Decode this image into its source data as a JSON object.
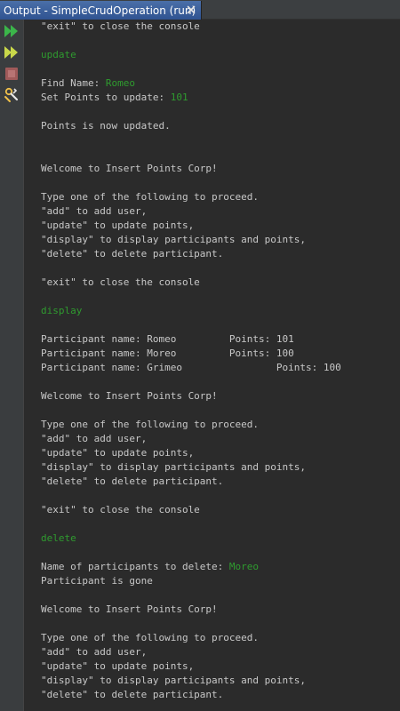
{
  "tab": {
    "title": "Output - SimpleCrudOperation (run)",
    "close_icon": "close-icon"
  },
  "toolbar": {
    "icons": [
      "rerun-icon",
      "rerun-with-options-icon",
      "stop-icon",
      "settings-icon"
    ]
  },
  "colors": {
    "background": "#2b2b2b",
    "text": "#c8c8c8",
    "user_input": "#2f9b2f",
    "tab_active": "#3d63a0"
  },
  "console": {
    "lines": [
      {
        "text": "\"exit\" to close the console"
      },
      {
        "text": ""
      },
      {
        "text": "update",
        "input": true
      },
      {
        "text": ""
      },
      {
        "prompt": "Find Name: ",
        "input_text": "Romeo"
      },
      {
        "prompt": "Set Points to update: ",
        "input_text": "101"
      },
      {
        "text": ""
      },
      {
        "text": "Points is now updated."
      },
      {
        "text": ""
      },
      {
        "text": ""
      },
      {
        "text": "Welcome to Insert Points Corp!"
      },
      {
        "text": ""
      },
      {
        "text": "Type one of the following to proceed."
      },
      {
        "text": "\"add\" to add user,"
      },
      {
        "text": "\"update\" to update points,"
      },
      {
        "text": "\"display\" to display participants and points,"
      },
      {
        "text": "\"delete\" to delete participant."
      },
      {
        "text": ""
      },
      {
        "text": "\"exit\" to close the console"
      },
      {
        "text": ""
      },
      {
        "text": "display",
        "input": true
      },
      {
        "text": ""
      },
      {
        "text": "Participant name: Romeo         Points: 101"
      },
      {
        "text": "Participant name: Moreo         Points: 100"
      },
      {
        "text": "Participant name: Grimeo                Points: 100"
      },
      {
        "text": ""
      },
      {
        "text": "Welcome to Insert Points Corp!"
      },
      {
        "text": ""
      },
      {
        "text": "Type one of the following to proceed."
      },
      {
        "text": "\"add\" to add user,"
      },
      {
        "text": "\"update\" to update points,"
      },
      {
        "text": "\"display\" to display participants and points,"
      },
      {
        "text": "\"delete\" to delete participant."
      },
      {
        "text": ""
      },
      {
        "text": "\"exit\" to close the console"
      },
      {
        "text": ""
      },
      {
        "text": "delete",
        "input": true
      },
      {
        "text": ""
      },
      {
        "prompt": "Name of participants to delete: ",
        "input_text": "Moreo"
      },
      {
        "text": "Participant is gone"
      },
      {
        "text": ""
      },
      {
        "text": "Welcome to Insert Points Corp!"
      },
      {
        "text": ""
      },
      {
        "text": "Type one of the following to proceed."
      },
      {
        "text": "\"add\" to add user,"
      },
      {
        "text": "\"update\" to update points,"
      },
      {
        "text": "\"display\" to display participants and points,"
      },
      {
        "text": "\"delete\" to delete participant."
      }
    ]
  }
}
